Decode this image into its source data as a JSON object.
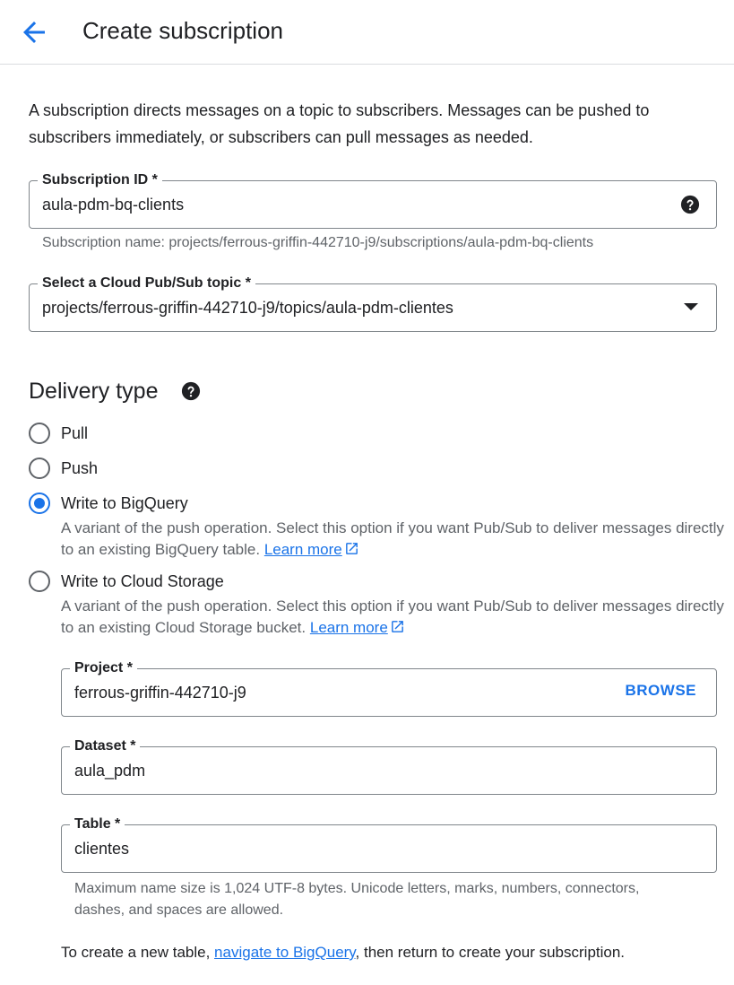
{
  "header": {
    "title": "Create subscription",
    "back_icon": "arrow-back-icon"
  },
  "intro": "A subscription directs messages on a topic to subscribers. Messages can be pushed to subscribers immediately, or subscribers can pull messages as needed.",
  "subscription_id": {
    "label": "Subscription ID *",
    "value": "aula-pdm-bq-clients",
    "hint": "Subscription name: projects/ferrous-griffin-442710-j9/subscriptions/aula-pdm-bq-clients"
  },
  "topic": {
    "label": "Select a Cloud Pub/Sub topic *",
    "value": "projects/ferrous-griffin-442710-j9/topics/aula-pdm-clientes"
  },
  "delivery": {
    "title": "Delivery type",
    "options": [
      {
        "label": "Pull",
        "checked": false
      },
      {
        "label": "Push",
        "checked": false
      },
      {
        "label": "Write to BigQuery",
        "checked": true,
        "desc": "A variant of the push operation. Select this option if you want Pub/Sub to deliver messages directly to an existing BigQuery table.",
        "link": "Learn more"
      },
      {
        "label": "Write to Cloud Storage",
        "checked": false,
        "desc": "A variant of the push operation. Select this option if you want Pub/Sub to deliver messages directly to an existing Cloud Storage bucket.",
        "link": "Learn more"
      }
    ]
  },
  "bigquery": {
    "project": {
      "label": "Project *",
      "value": "ferrous-griffin-442710-j9",
      "browse": "BROWSE"
    },
    "dataset": {
      "label": "Dataset *",
      "value": "aula_pdm"
    },
    "table": {
      "label": "Table *",
      "value": "clientes",
      "hint": "Maximum name size is 1,024 UTF-8 bytes. Unicode letters, marks, numbers, connectors, dashes, and spaces are allowed."
    },
    "footer": {
      "before": "To create a new table, ",
      "link": "navigate to BigQuery",
      "after": ", then return to create your subscription."
    }
  },
  "colors": {
    "accent": "#1a73e8",
    "text": "#202124",
    "secondary": "#5f6368",
    "border": "#80868b"
  }
}
